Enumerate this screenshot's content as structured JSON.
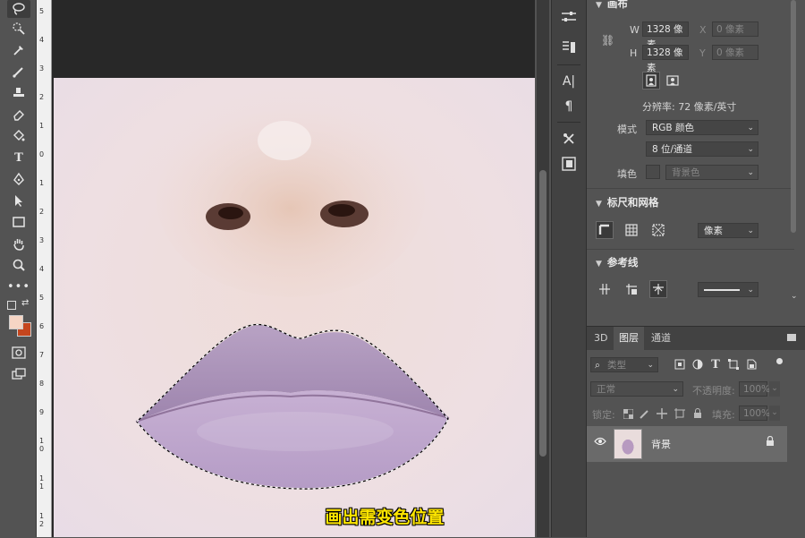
{
  "canvas_section": {
    "title": "画布",
    "w_label": "W",
    "w_value": "1328 像素",
    "h_label": "H",
    "h_value": "1328 像素",
    "x_label": "X",
    "x_value": "0 像素",
    "y_label": "Y",
    "y_value": "0 像素",
    "resolution": "分辨率: 72 像素/英寸",
    "mode_label": "模式",
    "mode_value": "RGB 颜色",
    "depth_value": "8 位/通道",
    "fill_label": "填色",
    "fill_value": "背景色"
  },
  "rulers_section": {
    "title": "标尺和网格",
    "unit_value": "像素"
  },
  "guides_section": {
    "title": "参考线"
  },
  "layers_panel": {
    "tabs": [
      "3D",
      "图层",
      "通道"
    ],
    "active_tab": "图层",
    "filter_placeholder": "类型",
    "blend_mode": "正常",
    "opacity_label": "不透明度:",
    "opacity_value": "100%",
    "lock_label": "锁定:",
    "fill_label": "填充:",
    "fill_value": "100%",
    "layers": [
      {
        "name": "背景",
        "visible": true,
        "locked": true
      }
    ]
  },
  "ruler_left_ticks": [
    "5",
    "4",
    "3",
    "2",
    "1",
    "0",
    "1",
    "2",
    "3",
    "4",
    "5",
    "6",
    "7",
    "8",
    "9",
    "1 0",
    "1 1",
    "1 2"
  ],
  "caption": "画出需变色位置",
  "colors": {
    "foreground": "#f6d5c4",
    "background": "#c5461e",
    "ui_bg": "#535353"
  }
}
